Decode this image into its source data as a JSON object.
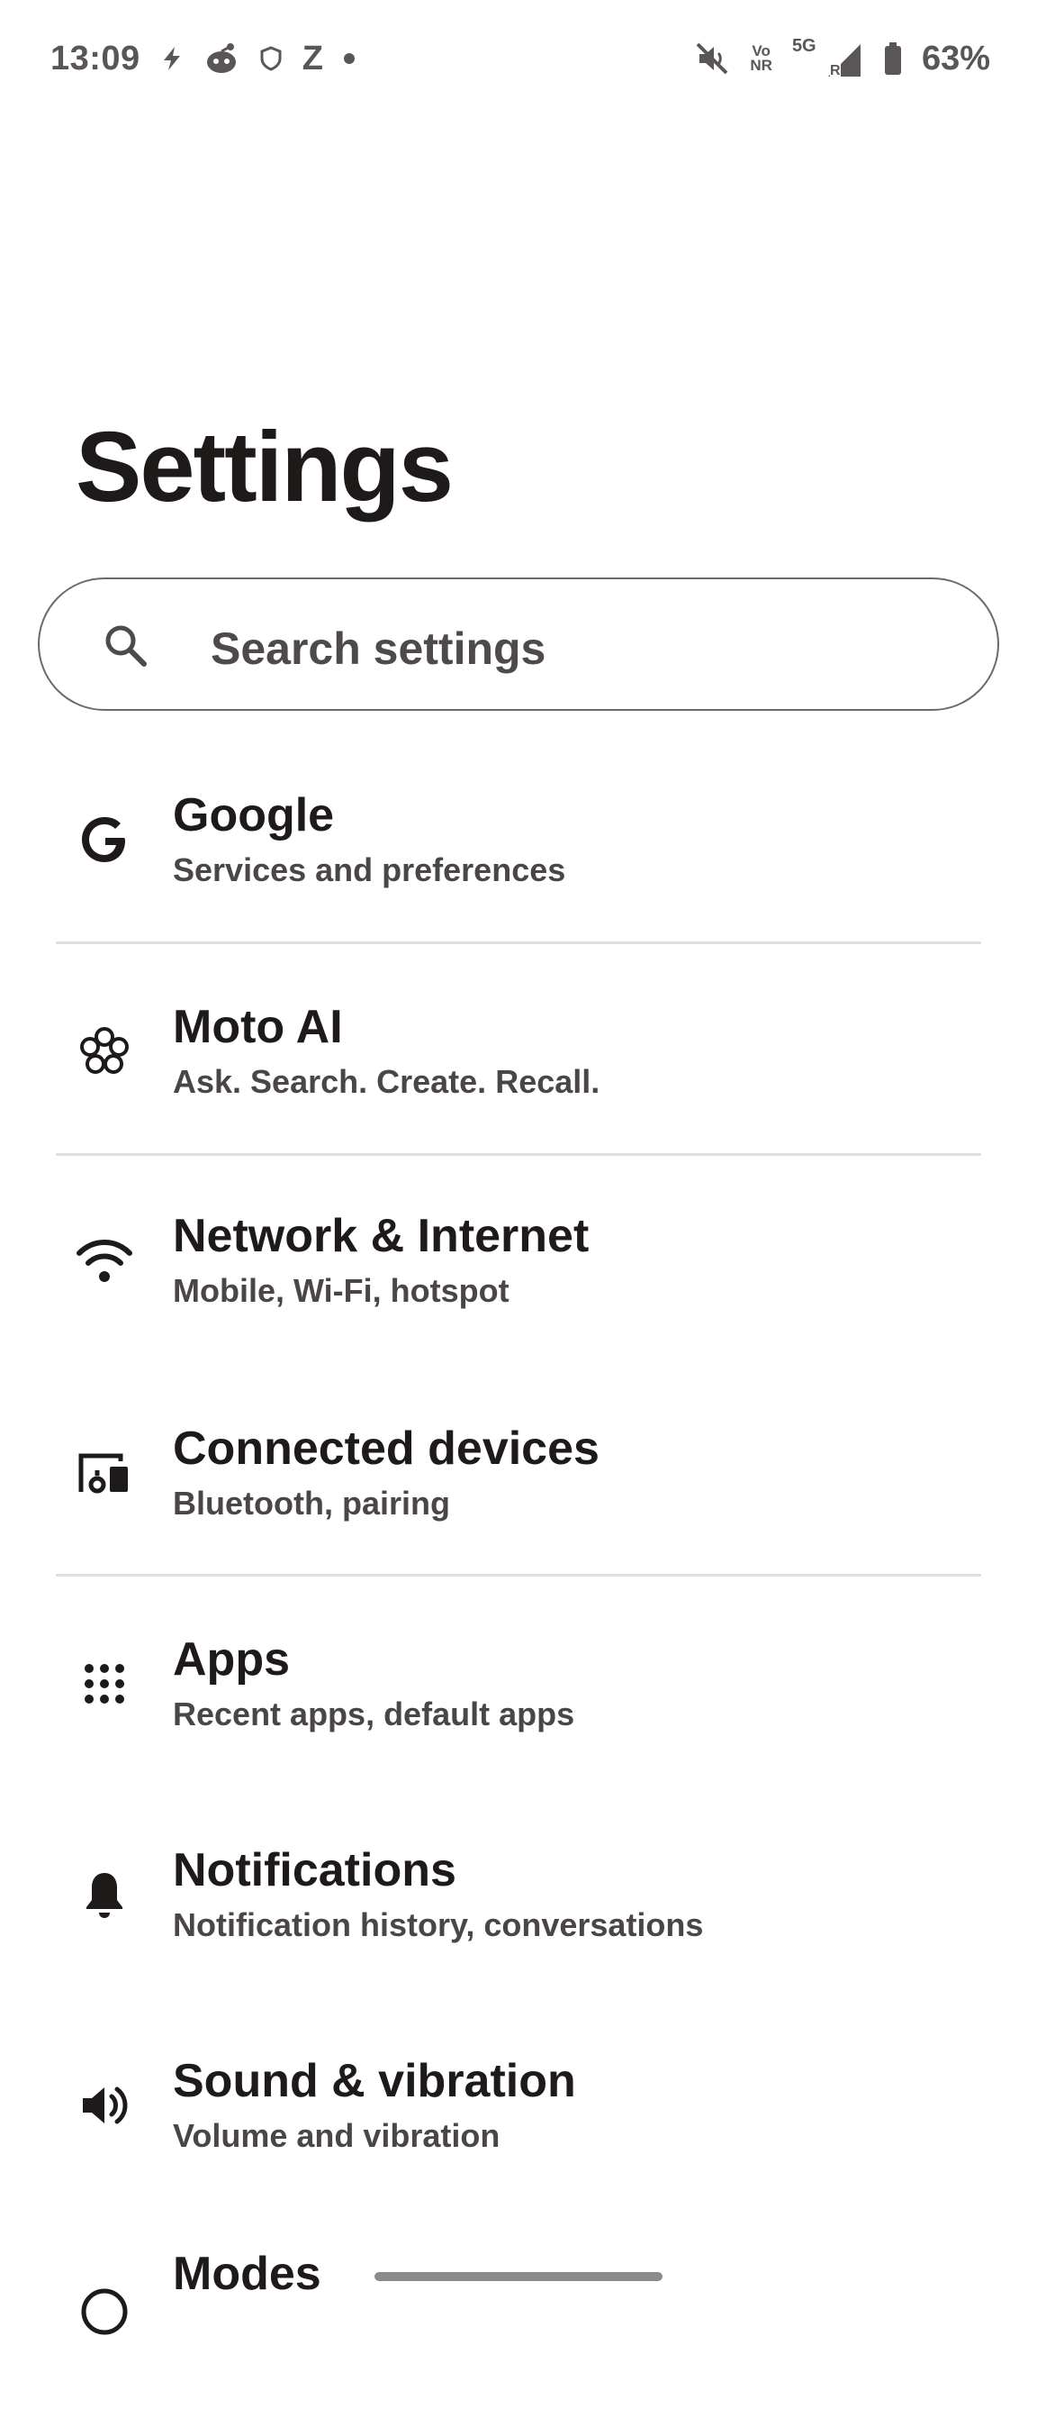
{
  "status_bar": {
    "time": "13:09",
    "left_icons": [
      "bolt-icon",
      "reddit-icon",
      "shield-icon",
      "z-app-icon",
      "dot-icon"
    ],
    "z_label": "Z",
    "volte_top": "Vo",
    "volte_bottom": "NR",
    "network": "5G",
    "roaming": "R",
    "battery_percent": "63%"
  },
  "page": {
    "title": "Settings"
  },
  "search": {
    "placeholder": "Search settings"
  },
  "items": [
    {
      "title": "Google",
      "subtitle": "Services and preferences",
      "icon": "google-icon"
    },
    {
      "title": "Moto AI",
      "subtitle": "Ask. Search. Create. Recall.",
      "icon": "moto-ai-icon"
    },
    {
      "title": "Network & Internet",
      "subtitle": "Mobile, Wi-Fi, hotspot",
      "icon": "wifi-icon"
    },
    {
      "title": "Connected devices",
      "subtitle": "Bluetooth, pairing",
      "icon": "devices-icon"
    },
    {
      "title": "Apps",
      "subtitle": "Recent apps, default apps",
      "icon": "apps-grid-icon"
    },
    {
      "title": "Notifications",
      "subtitle": "Notification history, conversations",
      "icon": "bell-icon"
    },
    {
      "title": "Sound & vibration",
      "subtitle": "Volume and vibration",
      "icon": "speaker-icon"
    },
    {
      "title": "Modes",
      "subtitle": "",
      "icon": "modes-icon"
    }
  ],
  "colors": {
    "background": "#ffffff",
    "text_primary": "#1f1a1a",
    "text_secondary": "#4a4646",
    "divider": "#e2dede",
    "status_text": "#5a5656"
  }
}
